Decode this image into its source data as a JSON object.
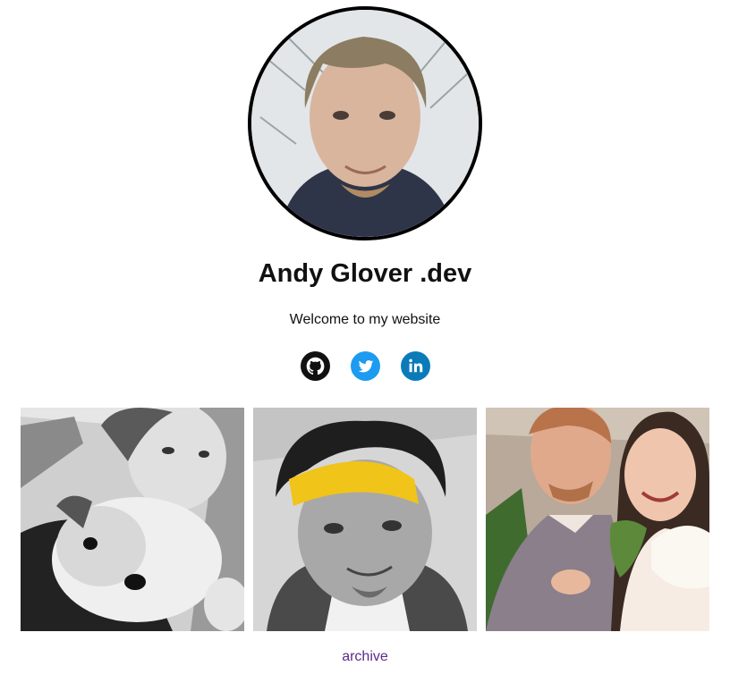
{
  "profile": {
    "avatar_icon": "avatar-photo",
    "title": "Andy Glover .dev",
    "tagline": "Welcome to my website"
  },
  "social_links": [
    {
      "icon": "github-icon",
      "color": "#111111"
    },
    {
      "icon": "twitter-icon",
      "color": "#1d9bf0"
    },
    {
      "icon": "linkedin-icon",
      "color": "#0a7bb8"
    }
  ],
  "gallery": [
    {
      "icon": "photo-with-dog"
    },
    {
      "icon": "photo-yellow-headband"
    },
    {
      "icon": "photo-wedding"
    }
  ],
  "footer": {
    "archive_label": "archive"
  }
}
